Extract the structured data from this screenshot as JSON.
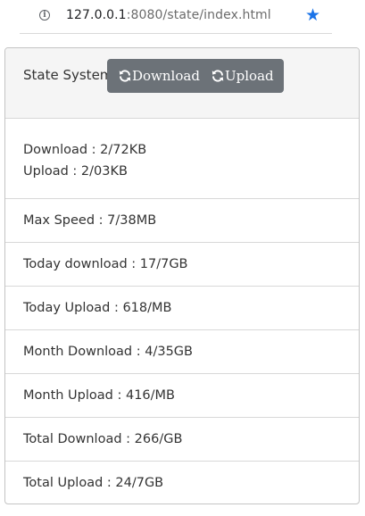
{
  "browser": {
    "url_host": "127.0.0.1",
    "url_rest": ":8080/state/index.html",
    "accent": "#1a73e8"
  },
  "panel": {
    "title": "State System",
    "buttons": {
      "download_label": "Download",
      "upload_label": "Upload",
      "color": "#6c7278"
    }
  },
  "stats": {
    "download": "Download : 2/72KB",
    "upload": "Upload : 2/03KB",
    "max_speed": "Max Speed : 7/38MB",
    "today_download": "Today download : 17/7GB",
    "today_upload": "Today Upload : 618/MB",
    "month_download": "Month Download : 4/35GB",
    "month_upload": "Month Upload : 416/MB",
    "total_download": "Total Download : 266/GB",
    "total_upload": "Total Upload : 24/7GB"
  }
}
